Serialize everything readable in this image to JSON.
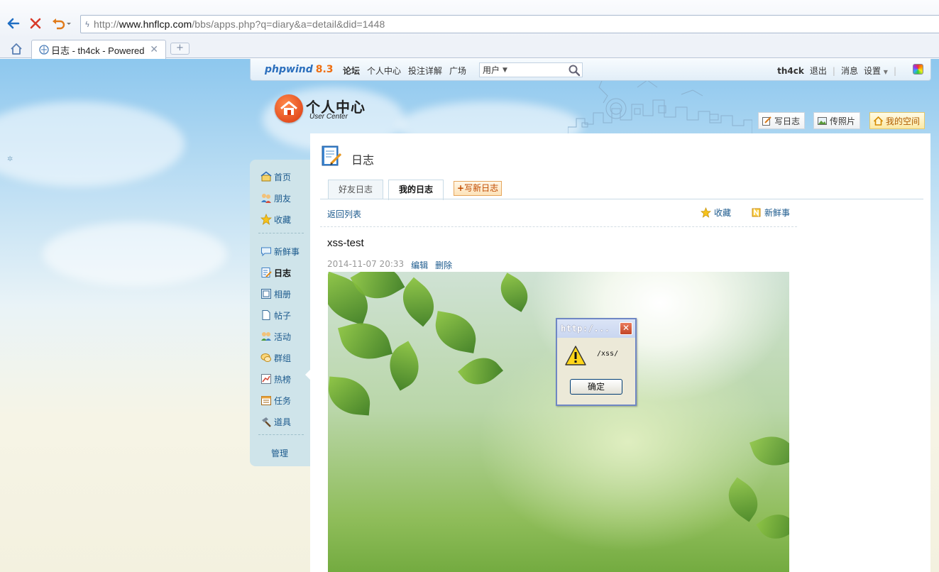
{
  "browser": {
    "url_scheme": "http://",
    "url_domain": "www.hnflcp.com",
    "url_path": "/bbs/apps.php?q=diary&a=detail&did=1448",
    "tab_title": "日志 - th4ck - Powered b",
    "new_tab": "+"
  },
  "topbar": {
    "brand": "phpwind",
    "version": "8.3",
    "links": [
      "论坛",
      "个人中心",
      "投注详解",
      "广场"
    ],
    "search_type": "用户",
    "username": "th4ck",
    "logout": "退出",
    "messages": "消息",
    "settings": "设置"
  },
  "logo": {
    "cn": "个人中心",
    "en": "User Center"
  },
  "quick": {
    "write": "写日志",
    "photo": "传照片",
    "space": "我的空间"
  },
  "sidebar": {
    "items": [
      "首页",
      "朋友",
      "收藏",
      "新鲜事",
      "日志",
      "相册",
      "帖子",
      "活动",
      "群组",
      "热榜",
      "任务",
      "道具"
    ],
    "manage": "管理"
  },
  "main": {
    "title": "日志",
    "tab_friends": "好友日志",
    "tab_mine": "我的日志",
    "write_new": "写新日志",
    "back": "返回列表",
    "favorite": "收藏",
    "fresh": "新鲜事",
    "diary_title": "xss-test",
    "date": "2014-11-07 20:33",
    "edit": "编辑",
    "delete": "删除"
  },
  "alert": {
    "title": "http:/...",
    "message": "/xss/",
    "ok": "确定"
  },
  "colors": {
    "link": "#1c5a8d",
    "brand": "#2b6fbd",
    "version": "#ef6e10",
    "sidebar": "#cfe4ea"
  }
}
